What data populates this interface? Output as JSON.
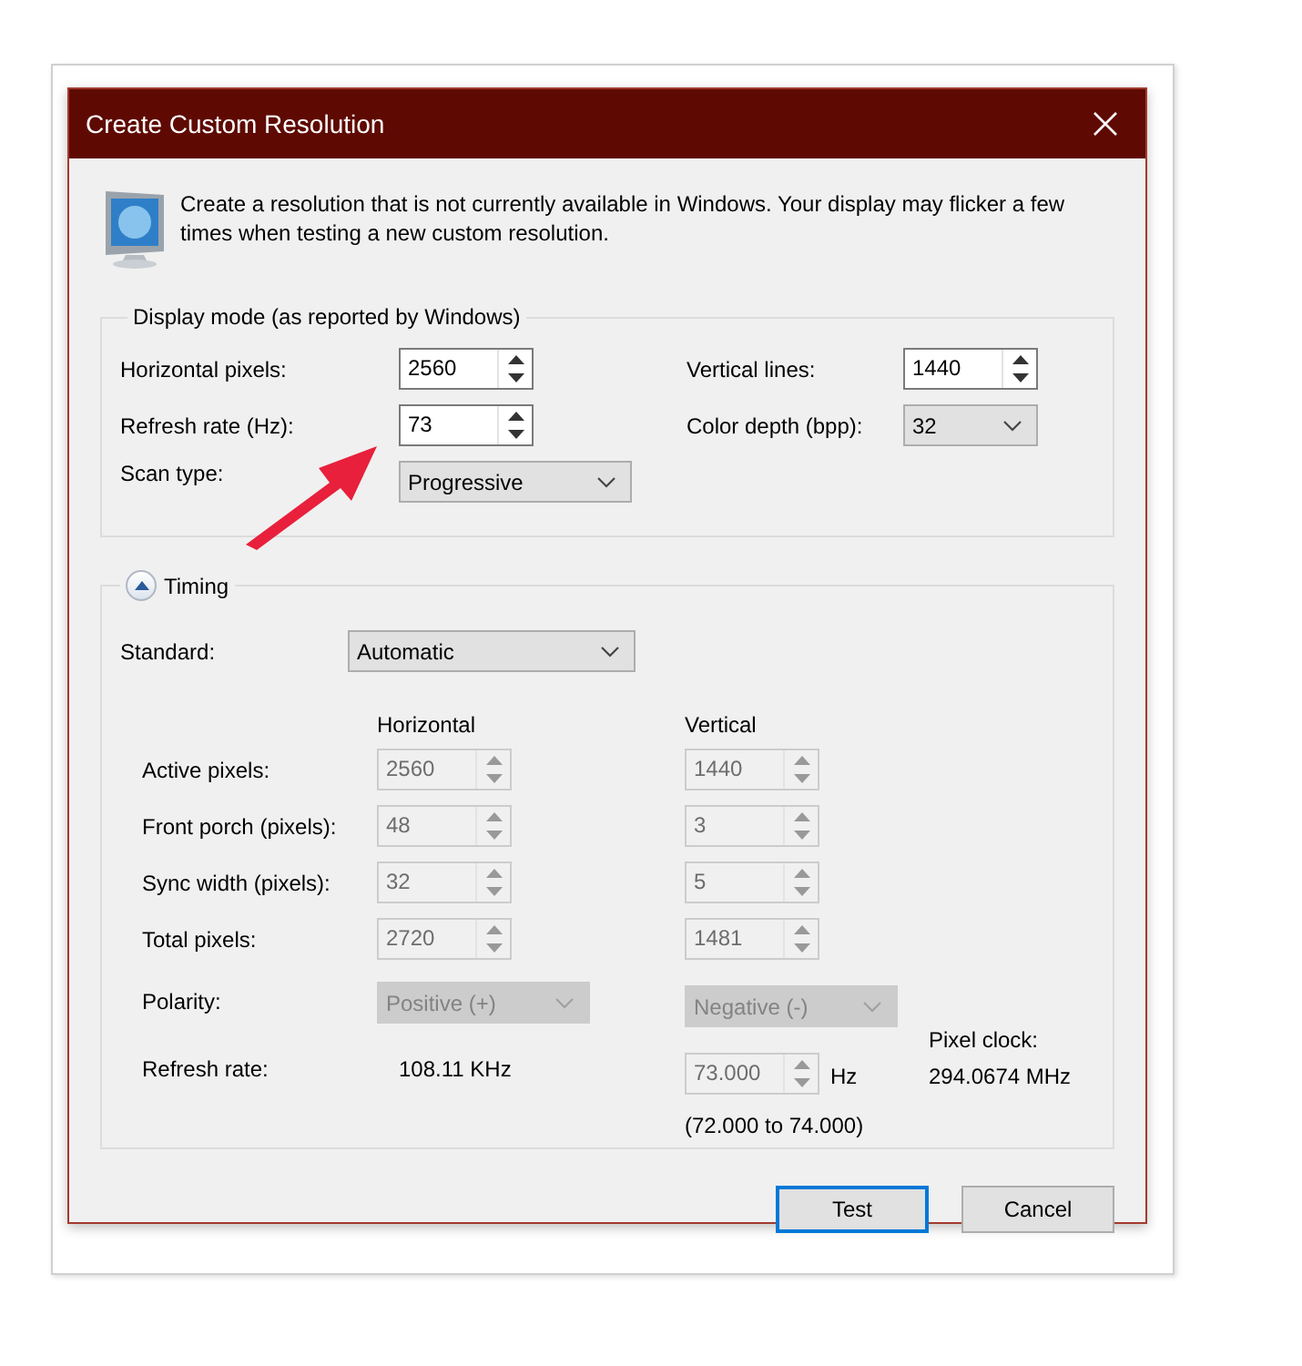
{
  "window": {
    "title": "Create Custom Resolution"
  },
  "intro": "Create a resolution that is not currently available in Windows. Your display may flicker a few times when testing a new custom resolution.",
  "display_mode": {
    "legend": "Display mode (as reported by Windows)",
    "fields": [
      {
        "label": "Horizontal pixels:",
        "kind": "spinner",
        "value": "2560",
        "disabled": false
      },
      {
        "label": "Vertical lines:",
        "kind": "spinner",
        "value": "1440",
        "disabled": false
      },
      {
        "label": "Refresh rate (Hz):",
        "kind": "spinner",
        "value": "73",
        "disabled": false
      },
      {
        "label": "Color depth (bpp):",
        "kind": "dropdown",
        "value": "32",
        "disabled": false
      },
      {
        "label": "Scan type:",
        "kind": "dropdown",
        "value": "Progressive",
        "disabled": false
      }
    ]
  },
  "timing": {
    "legend": "Timing",
    "expanded": true,
    "standard": {
      "label": "Standard:",
      "value": "Automatic"
    },
    "columns": [
      "Horizontal",
      "Vertical"
    ],
    "rows": [
      {
        "label": "Active pixels:",
        "kind": "spinner",
        "horizontal": "2560",
        "vertical": "1440",
        "disabled": true
      },
      {
        "label": "Front porch (pixels):",
        "kind": "spinner",
        "horizontal": "48",
        "vertical": "3",
        "disabled": true
      },
      {
        "label": "Sync width (pixels):",
        "kind": "spinner",
        "horizontal": "32",
        "vertical": "5",
        "disabled": true
      },
      {
        "label": "Total pixels:",
        "kind": "spinner",
        "horizontal": "2720",
        "vertical": "1481",
        "disabled": true
      },
      {
        "label": "Polarity:",
        "kind": "dropdown",
        "horizontal": "Positive (+)",
        "vertical": "Negative (-)",
        "disabled": true
      },
      {
        "label": "Refresh rate:",
        "kind": "rate",
        "horizontal": "108.11 KHz",
        "vertical": "73.000",
        "unit": "Hz",
        "range": "(72.000 to 74.000)",
        "disabled": true
      }
    ],
    "pixel_clock": {
      "label": "Pixel clock:",
      "value": "294.0674 MHz"
    }
  },
  "buttons": [
    {
      "label": "Test",
      "default": true
    },
    {
      "label": "Cancel",
      "default": false
    }
  ]
}
